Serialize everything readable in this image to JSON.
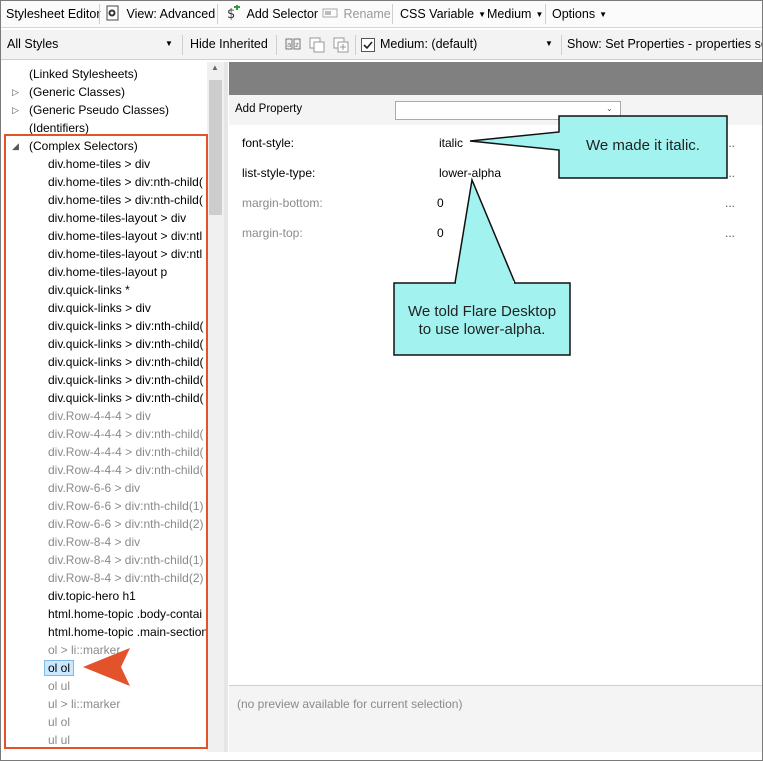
{
  "toolbar1": {
    "title": "Stylesheet Editor",
    "view_label": "View: Advanced",
    "add_selector_label": "Add Selector",
    "rename_label": "Rename",
    "css_variable_label": "CSS Variable",
    "medium_label": "Medium",
    "options_label": "Options"
  },
  "toolbar2": {
    "filter_value": "All Styles",
    "hide_inherited_label": "Hide Inherited",
    "medium_dropdown_value": "Medium: (default)",
    "show_label": "Show: Set Properties - properties set"
  },
  "tree": {
    "items": [
      {
        "label": "(Linked Stylesheets)"
      },
      {
        "label": "(Generic Classes)"
      },
      {
        "label": "(Generic Pseudo Classes)"
      },
      {
        "label": "(Identifiers)"
      },
      {
        "label": "(Complex Selectors)"
      },
      {
        "label": "div.home-tiles > div"
      },
      {
        "label": "div.home-tiles > div:nth-child("
      },
      {
        "label": "div.home-tiles > div:nth-child("
      },
      {
        "label": "div.home-tiles-layout > div"
      },
      {
        "label": "div.home-tiles-layout > div:ntl"
      },
      {
        "label": "div.home-tiles-layout > div:ntl"
      },
      {
        "label": "div.home-tiles-layout p"
      },
      {
        "label": "div.quick-links *"
      },
      {
        "label": "div.quick-links > div"
      },
      {
        "label": "div.quick-links > div:nth-child("
      },
      {
        "label": "div.quick-links > div:nth-child("
      },
      {
        "label": "div.quick-links > div:nth-child("
      },
      {
        "label": "div.quick-links > div:nth-child("
      },
      {
        "label": "div.quick-links > div:nth-child("
      },
      {
        "label": "div.Row-4-4-4 > div"
      },
      {
        "label": "div.Row-4-4-4 > div:nth-child("
      },
      {
        "label": "div.Row-4-4-4 > div:nth-child("
      },
      {
        "label": "div.Row-4-4-4 > div:nth-child("
      },
      {
        "label": "div.Row-6-6 > div"
      },
      {
        "label": "div.Row-6-6 > div:nth-child(1)"
      },
      {
        "label": "div.Row-6-6 > div:nth-child(2)"
      },
      {
        "label": "div.Row-8-4 > div"
      },
      {
        "label": "div.Row-8-4 > div:nth-child(1)"
      },
      {
        "label": "div.Row-8-4 > div:nth-child(2)"
      },
      {
        "label": "div.topic-hero h1"
      },
      {
        "label": "html.home-topic .body-contai"
      },
      {
        "label": "html.home-topic .main-section"
      },
      {
        "label": "ol > li::marker"
      },
      {
        "label": "ol ol"
      },
      {
        "label": "ol ul"
      },
      {
        "label": "ul > li::marker"
      },
      {
        "label": "ul ol"
      },
      {
        "label": "ul ul"
      }
    ]
  },
  "properties": {
    "add_property_label": "Add Property",
    "rows": [
      {
        "name": "font-style:",
        "value": "italic",
        "more": "..."
      },
      {
        "name": "list-style-type:",
        "value": "lower-alpha",
        "more": "..."
      },
      {
        "name": "margin-bottom:",
        "value": "0",
        "more": "..."
      },
      {
        "name": "margin-top:",
        "value": "0",
        "more": "..."
      }
    ]
  },
  "preview": {
    "text": "(no preview available for current selection)"
  },
  "callouts": {
    "italic": "We made it italic.",
    "lower_alpha_line1": "We told Flare Desktop",
    "lower_alpha_line2": "to use lower-alpha."
  },
  "colors": {
    "callout_fill": "#a2f3f0",
    "highlight_red": "#e2532b",
    "selection_fill": "#cce8ff",
    "header_gray": "#808080"
  }
}
